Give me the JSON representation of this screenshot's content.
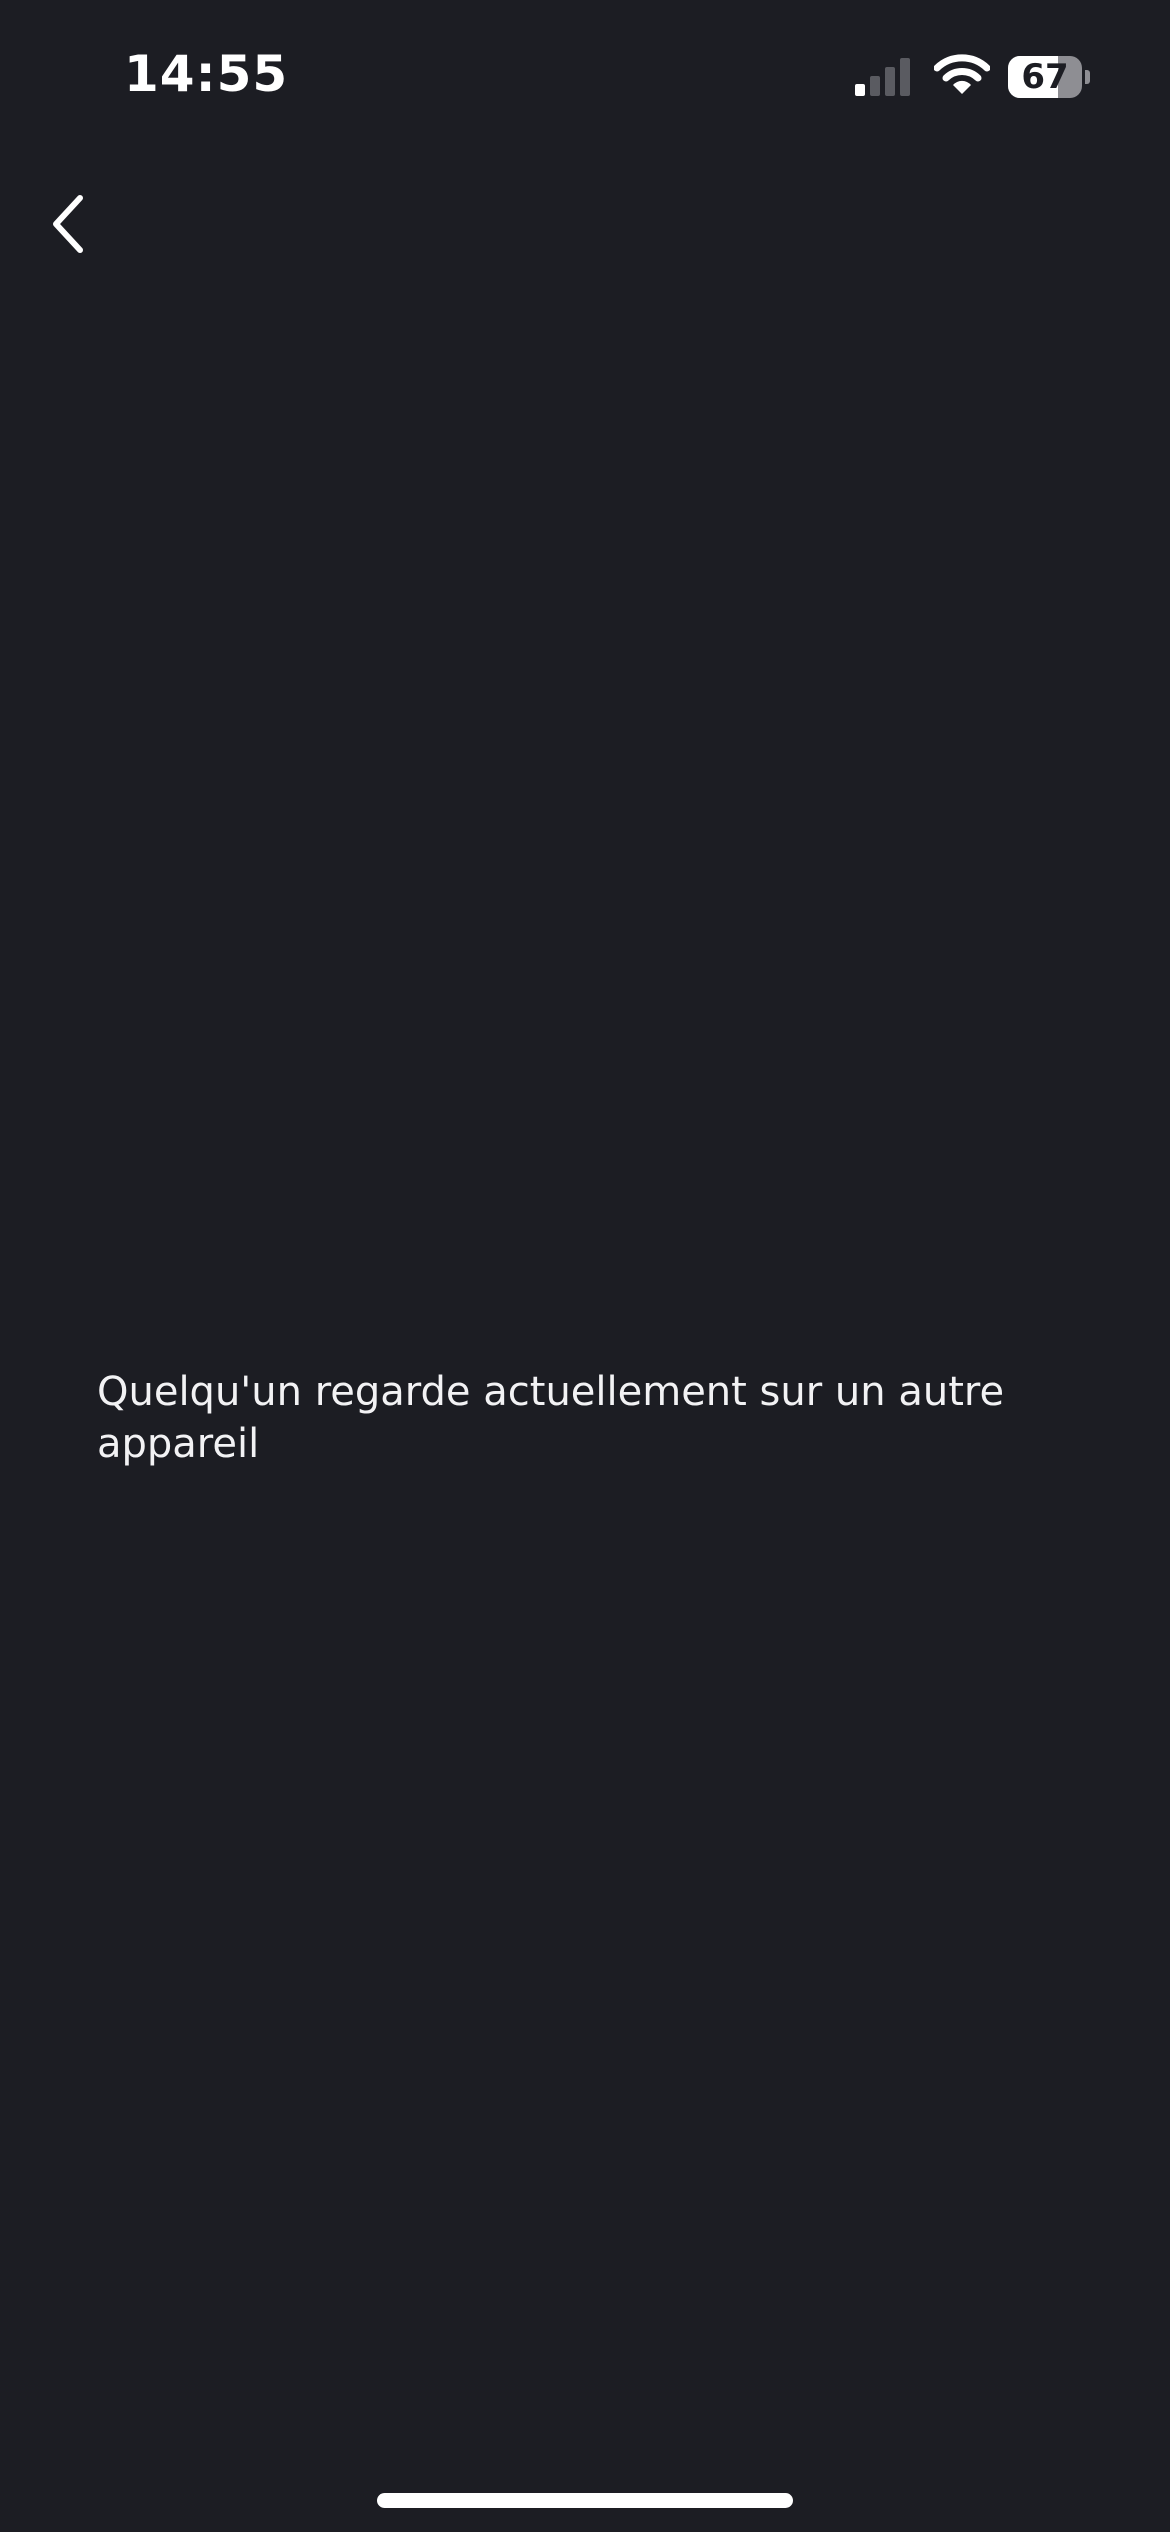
{
  "status_bar": {
    "time": "14:55",
    "signal_icon": "cellular-signal-icon",
    "signal_bars_active": 1,
    "signal_bars_total": 4,
    "wifi_icon": "wifi-icon",
    "battery_icon": "battery-icon",
    "battery_level": "67",
    "battery_fraction": 0.67
  },
  "navigation": {
    "back_icon": "chevron-left-icon"
  },
  "main": {
    "message": "Quelqu'un regarde actuellement sur un autre appareil"
  },
  "colors": {
    "background": "#1c1d23",
    "text": "#ffffff",
    "inactive": "#5a5b61"
  }
}
